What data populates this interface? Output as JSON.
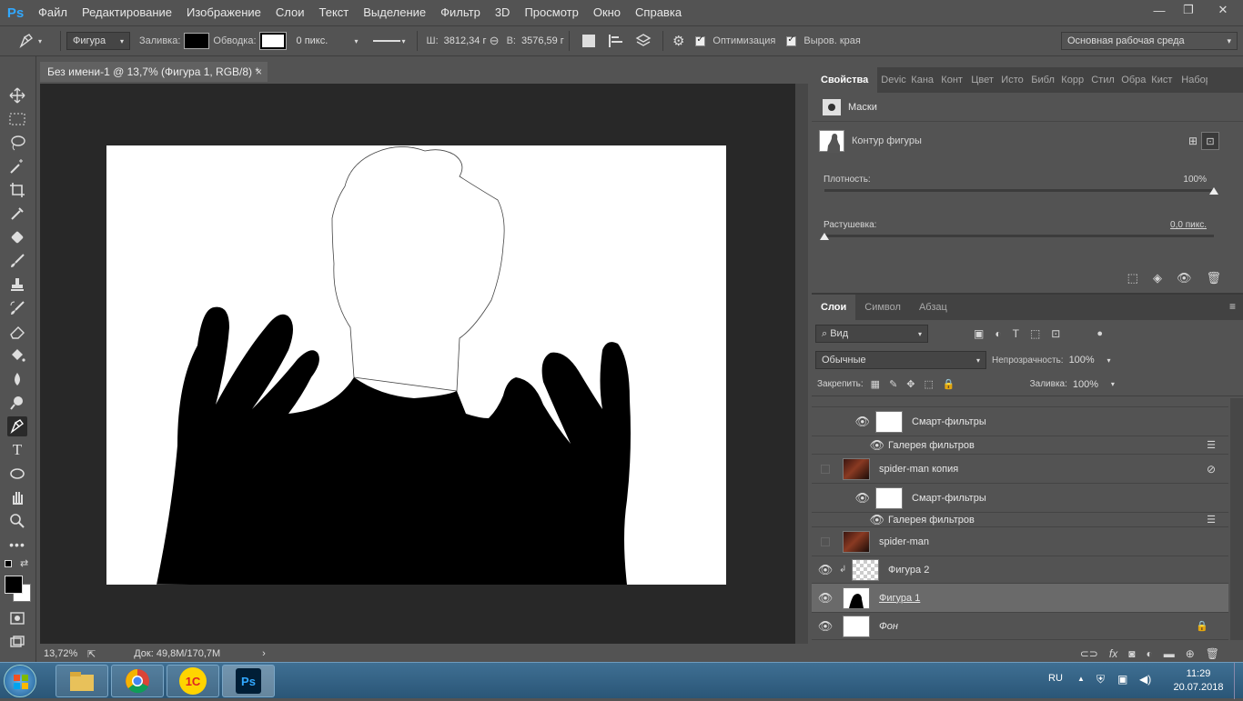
{
  "app": {
    "logo": "Ps"
  },
  "menu": [
    "Файл",
    "Редактирование",
    "Изображение",
    "Слои",
    "Текст",
    "Выделение",
    "Фильтр",
    "3D",
    "Просмотр",
    "Окно",
    "Справка"
  ],
  "window_controls": {
    "minimize": "—",
    "restore": "❐",
    "close": "✕"
  },
  "options": {
    "tool_mode": "Фигура",
    "fill_label": "Заливка:",
    "stroke_label": "Обводка:",
    "stroke_width": "0 пикс.",
    "w_label": "Ш:",
    "w_value": "3812,34 г",
    "link_icon": "⊖",
    "h_label": "В:",
    "h_value": "3576,59 г",
    "optimize_label": "Оптимизация",
    "align_edges_label": "Выров. края",
    "workspace": "Основная рабочая среда"
  },
  "document": {
    "tab_title": "Без имени-1 @ 13,7% (Фигура 1, RGB/8) *",
    "tab_close": "×",
    "zoom": "13,72%",
    "doc_info": "Док: 49,8M/170,7M",
    "status_arrow": "›"
  },
  "properties": {
    "tabs": [
      "Свойства",
      "Devic",
      "Кана",
      "Конт",
      "Цвет",
      "Исто",
      "Библ",
      "Корр",
      "Стил",
      "Обра",
      "Кист",
      "Набор"
    ],
    "section": "Маски",
    "mask_name": "Контур фигуры",
    "density_label": "Плотность:",
    "density_value": "100%",
    "density_level": 1.0,
    "feather_label": "Растушевка:",
    "feather_value": "0,0 пикс.",
    "feather_level": 0.0
  },
  "layers_panel": {
    "tabs": [
      "Слои",
      "Символ",
      "Абзац"
    ],
    "filter_label": "Вид",
    "blend_mode": "Обычные",
    "opacity_label": "Непрозрачность:",
    "opacity_value": "100%",
    "lock_label": "Закрепить:",
    "fill_label": "Заливка:",
    "fill_value": "100%",
    "layers": [
      {
        "name": "Смарт-фильтры",
        "kind": "smart-filter"
      },
      {
        "name": "Галерея фильтров",
        "kind": "filter"
      },
      {
        "name": "spider-man копия",
        "kind": "photo"
      },
      {
        "name": "Смарт-фильтры",
        "kind": "smart-filter"
      },
      {
        "name": "Галерея фильтров",
        "kind": "filter"
      },
      {
        "name": "spider-man",
        "kind": "photo"
      },
      {
        "name": "Фигура 2",
        "kind": "shape"
      },
      {
        "name": "Фигура 1",
        "kind": "shape-selected"
      },
      {
        "name": "Фон",
        "kind": "background"
      }
    ]
  },
  "taskbar": {
    "lang": "RU",
    "time": "11:29",
    "date": "20.07.2018",
    "app_1c": "1С",
    "app_ps": "Ps"
  }
}
